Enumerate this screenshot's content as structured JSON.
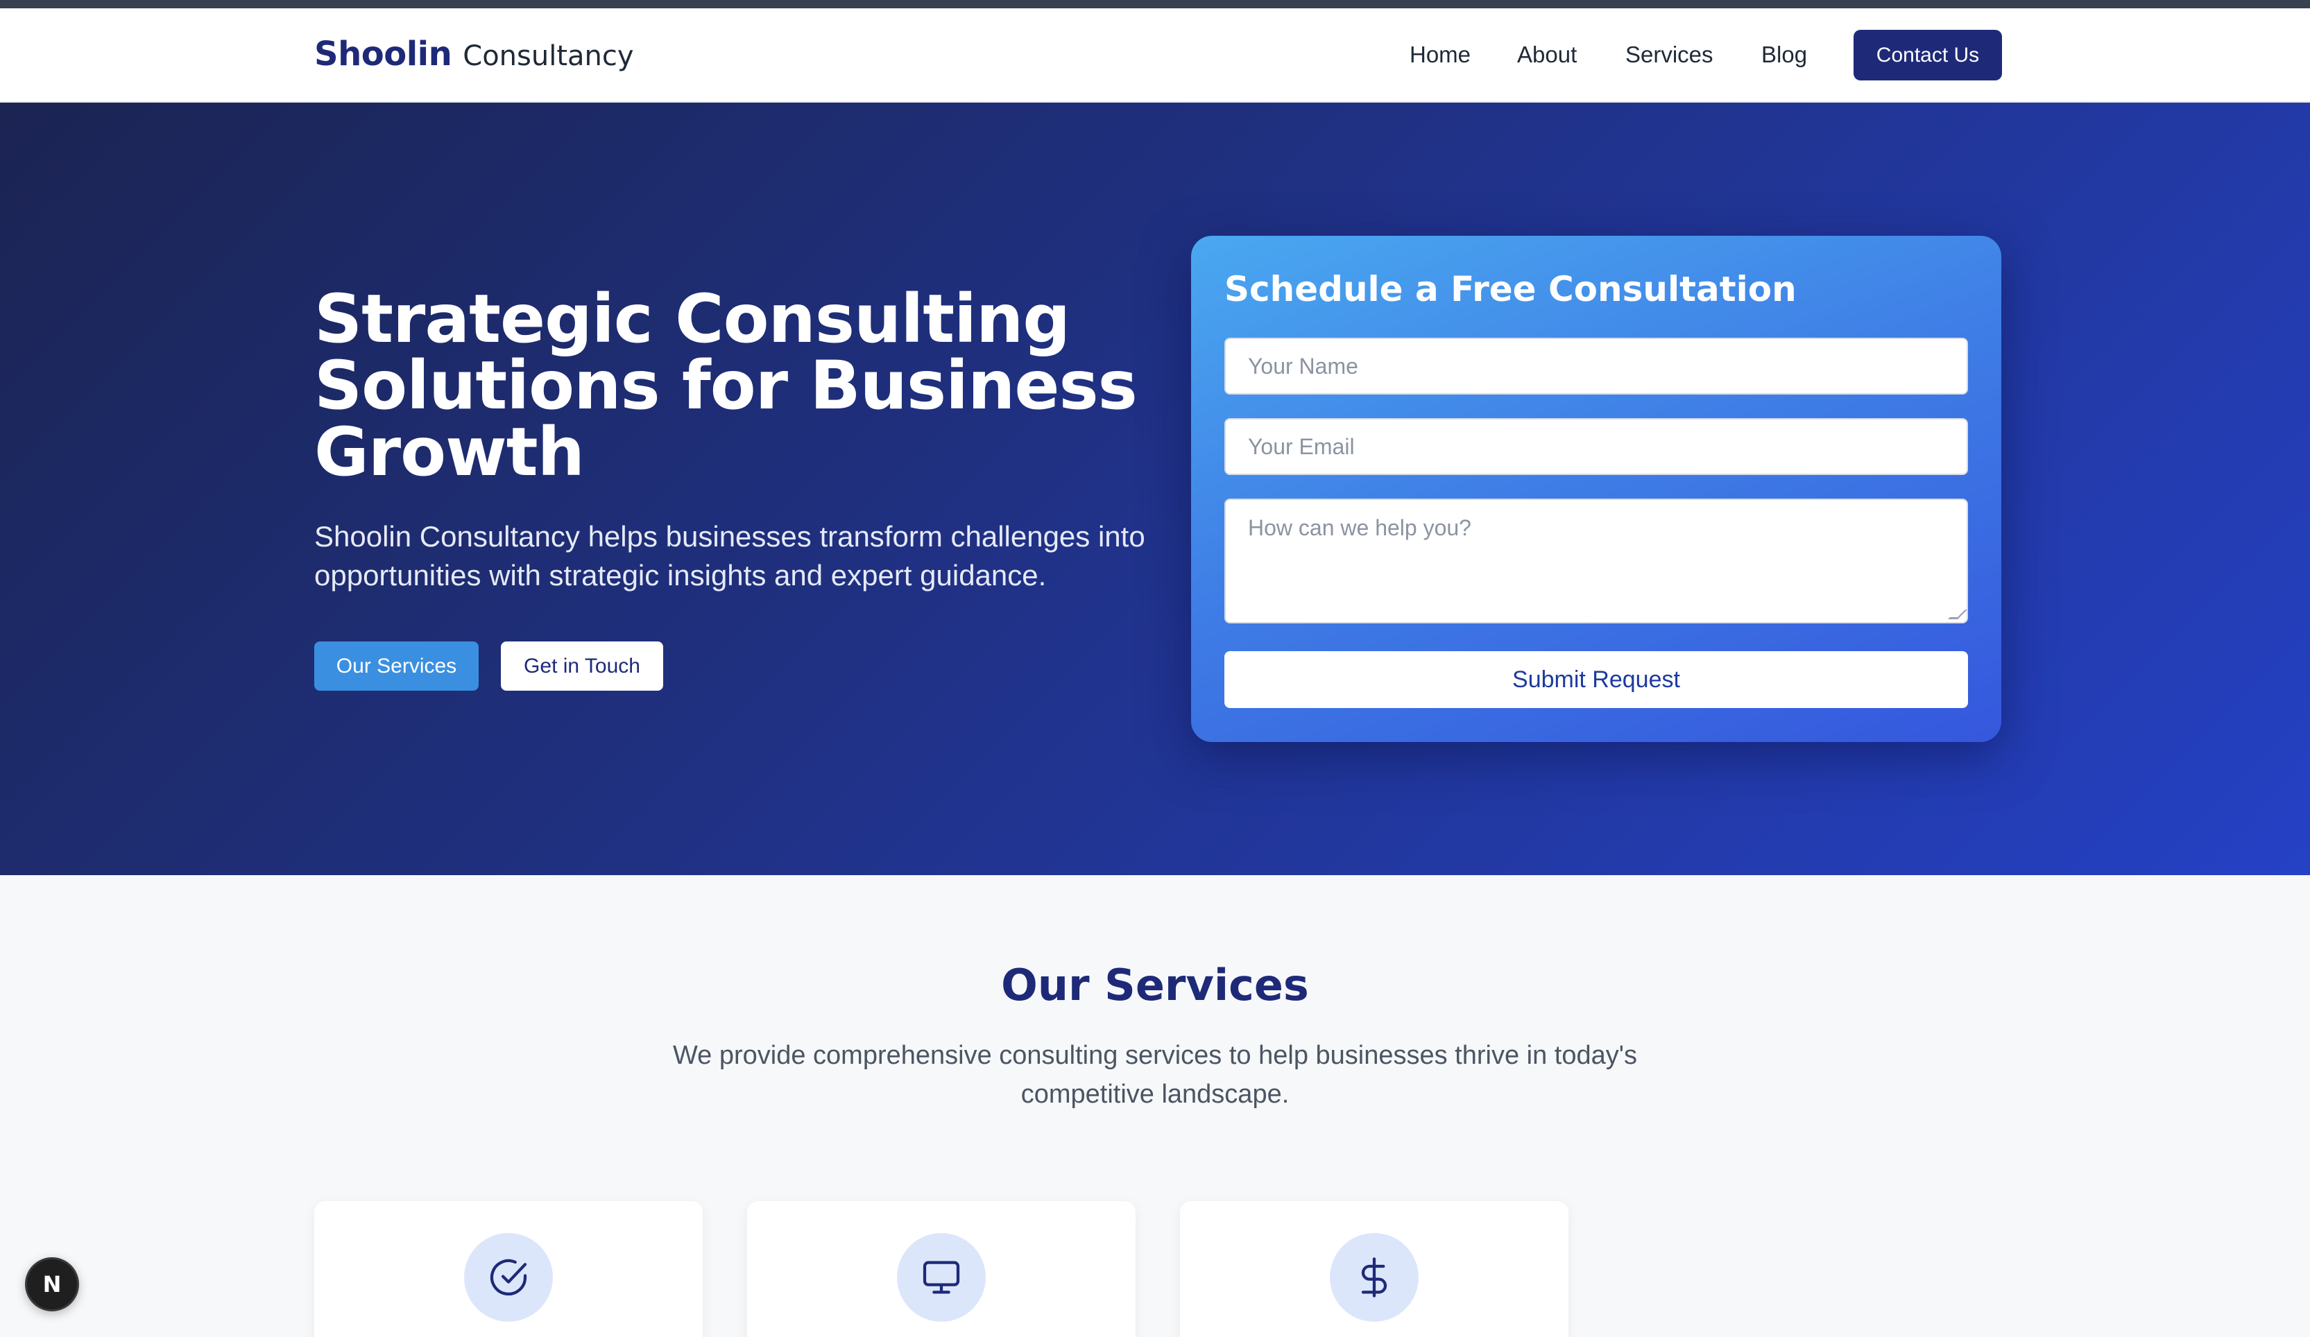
{
  "nav": {
    "brand_main": "Shoolin",
    "brand_sub": "Consultancy",
    "links": [
      "Home",
      "About",
      "Services",
      "Blog"
    ],
    "contact_label": "Contact Us"
  },
  "hero": {
    "title": "Strategic Consulting Solutions for Business Growth",
    "description": "Shoolin Consultancy helps businesses transform challenges into opportunities with strategic insights and expert guidance.",
    "primary_button": "Our Services",
    "secondary_button": "Get in Touch"
  },
  "form": {
    "title": "Schedule a Free Consultation",
    "name_placeholder": "Your Name",
    "email_placeholder": "Your Email",
    "message_placeholder": "How can we help you?",
    "submit_label": "Submit Request"
  },
  "services": {
    "title": "Our Services",
    "description": "We provide comprehensive consulting services to help businesses thrive in today's competitive landscape.",
    "cards": [
      {
        "icon": "check-circle-icon"
      },
      {
        "icon": "monitor-icon"
      },
      {
        "icon": "dollar-icon"
      }
    ]
  },
  "badge": {
    "letter": "N"
  },
  "colors": {
    "brand": "#1e2a78",
    "accent": "#3b8fe0",
    "icon_bg": "#dce6fb"
  }
}
